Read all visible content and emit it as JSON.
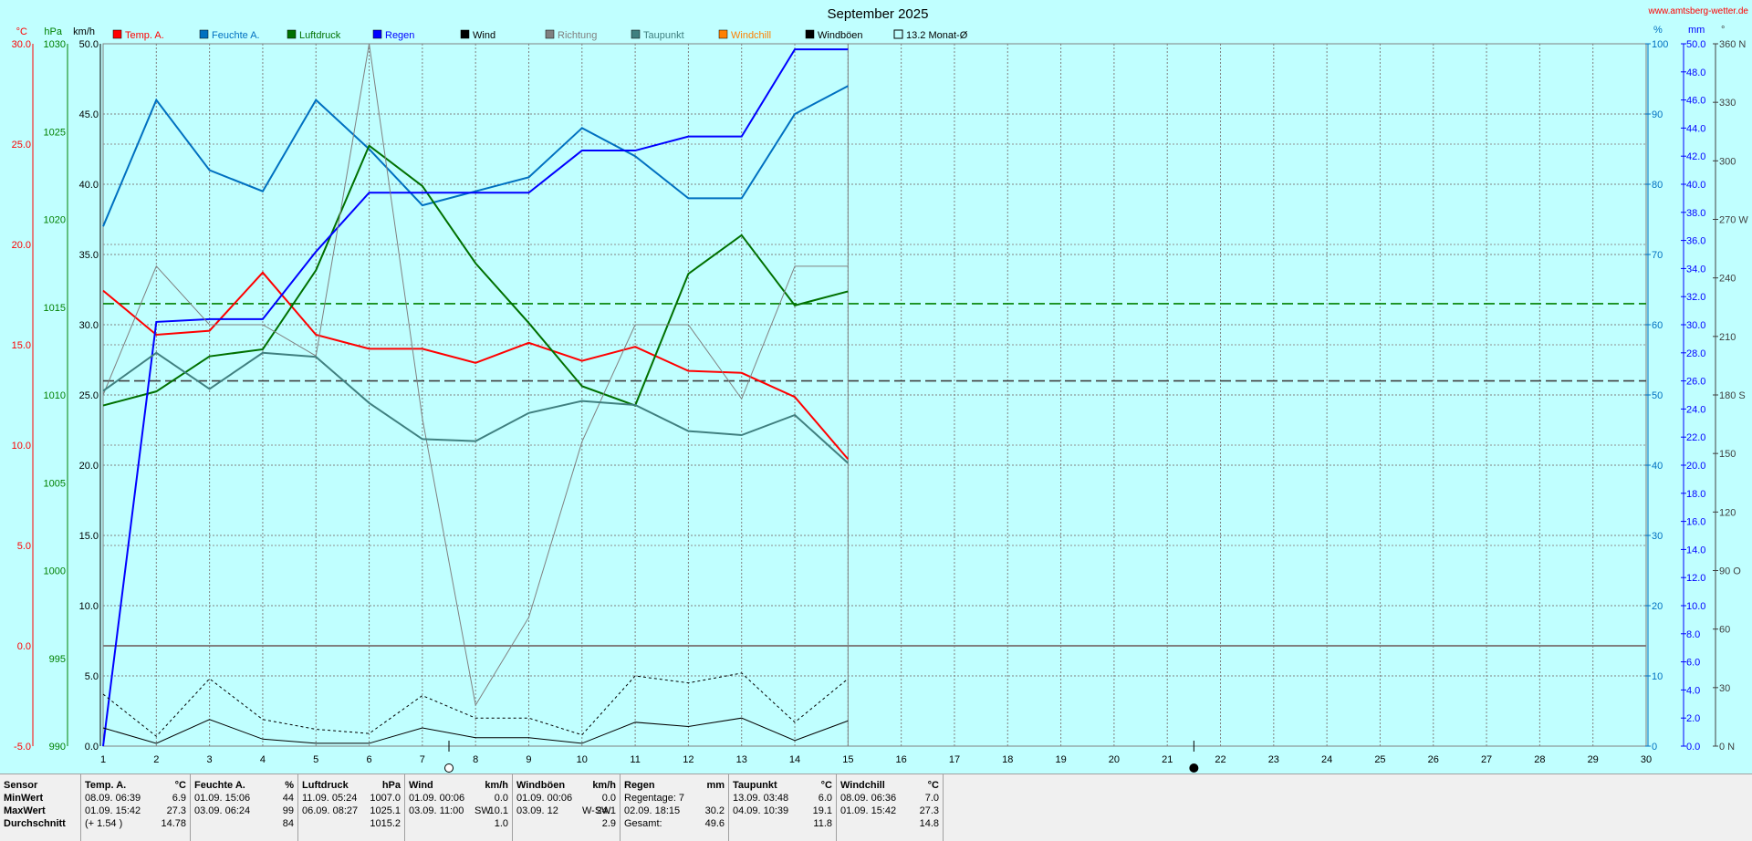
{
  "chart_data": {
    "type": "line",
    "title": "September 2025",
    "source": "www.amtsberg-wetter.de",
    "x_ticks": [
      "1",
      "2",
      "3",
      "4",
      "5",
      "6",
      "7",
      "8",
      "9",
      "10",
      "11",
      "12",
      "13",
      "14",
      "15",
      "16",
      "17",
      "18",
      "19",
      "20",
      "21",
      "22",
      "23",
      "24",
      "25",
      "26",
      "27",
      "28",
      "29",
      "30"
    ],
    "xlim": [
      1,
      30
    ],
    "x": [
      1,
      2,
      3,
      4,
      5,
      6,
      7,
      8,
      9,
      10,
      11,
      12,
      13,
      14,
      15
    ],
    "axes": {
      "temp": {
        "unit": "°C",
        "color": "#ff0000",
        "ticks": [
          "-5.0",
          "0.0",
          "5.0",
          "10.0",
          "15.0",
          "20.0",
          "25.0",
          "30.0"
        ],
        "lim": [
          -5,
          30
        ]
      },
      "pressure": {
        "unit": "hPa",
        "color": "#008000",
        "ticks": [
          "990",
          "995",
          "1000",
          "1005",
          "1010",
          "1015",
          "1020",
          "1025",
          "1030"
        ],
        "lim": [
          990,
          1030
        ]
      },
      "speed": {
        "unit": "km/h",
        "color": "#000000",
        "ticks": [
          "0.0",
          "5.0",
          "10.0",
          "15.0",
          "20.0",
          "25.0",
          "30.0",
          "35.0",
          "40.0",
          "45.0",
          "50.0"
        ],
        "lim": [
          0,
          50
        ]
      },
      "humidity": {
        "unit": "%",
        "color": "#0070c0",
        "ticks": [
          "0",
          "10",
          "20",
          "30",
          "40",
          "50",
          "60",
          "70",
          "80",
          "90",
          "100"
        ],
        "lim": [
          0,
          100
        ]
      },
      "rain": {
        "unit": "mm",
        "color": "#0000ff",
        "ticks": [
          "0.0",
          "2.0",
          "4.0",
          "6.0",
          "8.0",
          "10.0",
          "12.0",
          "14.0",
          "16.0",
          "18.0",
          "20.0",
          "22.0",
          "24.0",
          "26.0",
          "28.0",
          "30.0",
          "32.0",
          "34.0",
          "36.0",
          "38.0",
          "40.0",
          "42.0",
          "44.0",
          "46.0",
          "48.0",
          "50.0"
        ],
        "lim": [
          0,
          50
        ]
      },
      "direction": {
        "unit": "°",
        "color": "#404040",
        "ticks": [
          "0 N",
          "30",
          "60",
          "90 O",
          "120",
          "150",
          "180 S",
          "210",
          "240",
          "270 W",
          "300",
          "330",
          "360 N"
        ],
        "lim": [
          0,
          360
        ]
      }
    },
    "series": [
      {
        "name": "Temp. A.",
        "color": "#ff0000",
        "axis": "temp",
        "values": [
          17.7,
          15.5,
          15.7,
          18.6,
          15.5,
          14.8,
          14.8,
          14.1,
          15.1,
          14.2,
          14.9,
          13.7,
          13.6,
          12.4,
          9.3
        ]
      },
      {
        "name": "Feuchte A.",
        "color": "#0070c0",
        "axis": "humidity",
        "values": [
          74,
          92,
          82,
          79,
          92,
          85,
          77,
          79,
          81,
          88,
          84,
          78,
          78,
          90,
          94
        ]
      },
      {
        "name": "Luftdruck",
        "color": "#007000",
        "axis": "pressure",
        "values": [
          1009.4,
          1010.2,
          1012.2,
          1012.6,
          1017.1,
          1024.2,
          1021.9,
          1017.5,
          1014.1,
          1010.5,
          1009.4,
          1016.9,
          1019.1,
          1015.1,
          1015.9
        ]
      },
      {
        "name": "Regen",
        "color": "#0000ff",
        "axis": "rain",
        "values": [
          0.0,
          30.2,
          30.4,
          30.4,
          35.2,
          39.4,
          39.4,
          39.4,
          39.4,
          42.4,
          42.4,
          43.4,
          43.4,
          49.6,
          49.6
        ]
      },
      {
        "name": "Wind",
        "color": "#000000",
        "axis": "speed",
        "values": [
          1.3,
          0.2,
          1.9,
          0.5,
          0.2,
          0.2,
          1.3,
          0.6,
          0.6,
          0.2,
          1.7,
          1.4,
          2.0,
          0.4,
          1.8
        ]
      },
      {
        "name": "Richtung",
        "color": "#808080",
        "axis": "direction",
        "values": [
          180,
          246,
          216,
          216,
          200,
          360,
          168,
          21,
          66,
          156,
          216,
          216,
          178,
          246,
          246
        ]
      },
      {
        "name": "Taupunkt",
        "color": "#408080",
        "axis": "temp",
        "values": [
          12.7,
          14.6,
          12.8,
          14.6,
          14.4,
          12.1,
          10.3,
          10.2,
          11.6,
          12.2,
          12.0,
          10.7,
          10.5,
          11.5,
          9.1
        ]
      },
      {
        "name": "Windchill",
        "color": "#ff8000",
        "axis": "temp",
        "values": []
      },
      {
        "name": "Windböen",
        "color": "#000000",
        "axis": "speed",
        "values": [
          3.7,
          0.7,
          4.8,
          1.9,
          1.2,
          0.9,
          3.6,
          2.0,
          2.0,
          0.8,
          5.0,
          4.5,
          5.2,
          1.7,
          4.8
        ]
      }
    ],
    "monthly_avg_label": "13.2 Monat-Ø",
    "reference_lines": [
      {
        "name": "Temp. A. Monat-Ø",
        "axis": "temp",
        "value": 13.2,
        "color": "#404040",
        "style": "dashed"
      },
      {
        "name": "Luftdruck Monat-Ø",
        "axis": "pressure",
        "value": 1015.2,
        "color": "#008000",
        "style": "dashed"
      },
      {
        "name": "Nulllinie",
        "axis": "temp",
        "value": 0.0,
        "color": "#808080",
        "style": "solid"
      }
    ],
    "moon_markers": [
      {
        "day": 7.5,
        "phase": "full"
      },
      {
        "day": 21.5,
        "phase": "new"
      }
    ],
    "grid": true,
    "legend_position": "top"
  },
  "stats": {
    "row_labels": [
      "Sensor",
      "MinWert",
      "MaxWert",
      "Durchschnitt"
    ],
    "columns": [
      {
        "name": "Temp. A.",
        "unit": "°C",
        "min_time": "08.09.  06:39",
        "min": "6.9",
        "max_time": "01.09.  15:42",
        "max": "27.3",
        "avg_note": "(+ 1.54 )",
        "avg": "14.78"
      },
      {
        "name": "Feuchte A.",
        "unit": "%",
        "min_time": "01.09.  15:06",
        "min": "44",
        "max_time": "03.09.  06:24",
        "max": "99",
        "avg_note": "",
        "avg": "84"
      },
      {
        "name": "Luftdruck",
        "unit": "hPa",
        "min_time": "11.09.  05:24",
        "min": "1007.0",
        "max_time": "06.09.  08:27",
        "max": "1025.1",
        "avg_note": "",
        "avg": "1015.2"
      },
      {
        "name": "Wind",
        "unit": "km/h",
        "min_time": "01.09.  00:06",
        "min": "0.0",
        "max_time": "03.09.  11:00",
        "max_dir": "SW",
        "max": "10.1",
        "avg_note": "",
        "avg": "1.0"
      },
      {
        "name": "Windböen",
        "unit": "km/h",
        "min_time": "01.09.  00:06",
        "min": "0.0",
        "max_time": "03.09.  12",
        "max_dir": "W-SW",
        "max": "24.1",
        "avg_note": "",
        "avg": "2.9"
      },
      {
        "name": "Regen",
        "unit": "mm",
        "min_time": "Regentage: 7",
        "min": "",
        "max_time": "02.09.  18:15",
        "max": "30.2",
        "avg_note": "Gesamt:",
        "avg": "49.6"
      },
      {
        "name": "Taupunkt",
        "unit": "°C",
        "min_time": "13.09.  03:48",
        "min": "6.0",
        "max_time": "04.09.  10:39",
        "max": "19.1",
        "avg_note": "",
        "avg": "11.8"
      },
      {
        "name": "Windchill",
        "unit": "°C",
        "min_time": "08.09.  06:36",
        "min": "7.0",
        "max_time": "01.09.  15:42",
        "max": "27.3",
        "avg_note": "",
        "avg": "14.8"
      }
    ]
  }
}
